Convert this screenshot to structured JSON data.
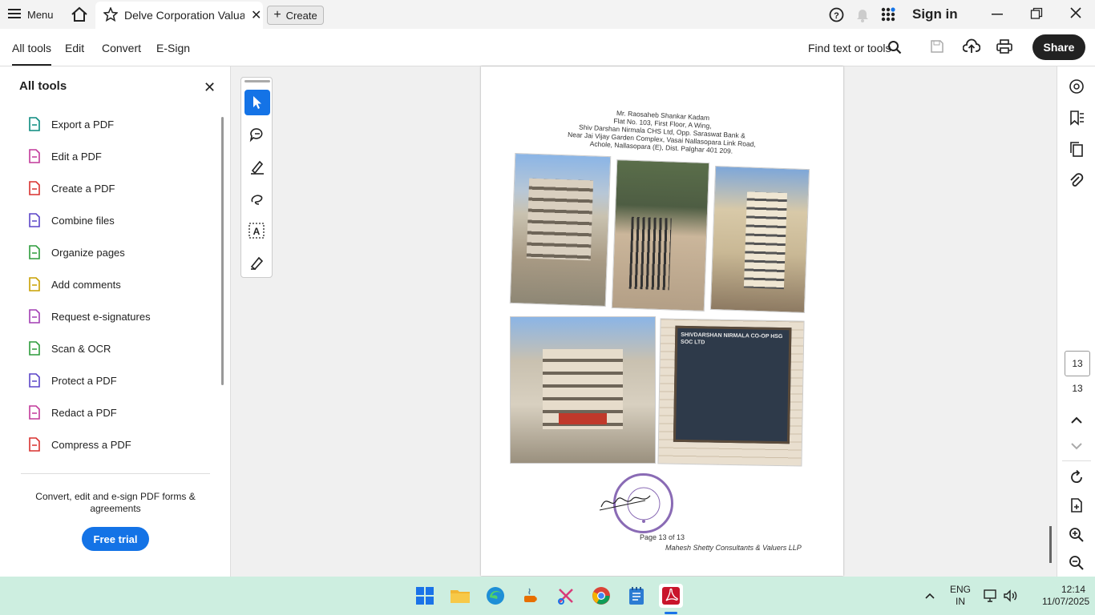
{
  "titlebar": {
    "menu_label": "Menu",
    "tab_title": "Delve Corporation Valua...",
    "create_label": "Create",
    "signin_label": "Sign in"
  },
  "toolbar": {
    "items": [
      "All tools",
      "Edit",
      "Convert",
      "E-Sign"
    ],
    "find_label": "Find text or tools",
    "share_label": "Share"
  },
  "panel": {
    "title": "All tools",
    "tools": [
      {
        "label": "Export a PDF",
        "icon": "export-pdf-icon",
        "color": "#0a8a7f"
      },
      {
        "label": "Edit a PDF",
        "icon": "edit-pdf-icon",
        "color": "#c2399a"
      },
      {
        "label": "Create a PDF",
        "icon": "create-pdf-icon",
        "color": "#d9312f"
      },
      {
        "label": "Combine files",
        "icon": "combine-files-icon",
        "color": "#5b45c8"
      },
      {
        "label": "Organize pages",
        "icon": "organize-pages-icon",
        "color": "#2d9c3c"
      },
      {
        "label": "Add comments",
        "icon": "add-comments-icon",
        "color": "#c9a000"
      },
      {
        "label": "Request e-signatures",
        "icon": "request-esign-icon",
        "color": "#a23db3"
      },
      {
        "label": "Scan & OCR",
        "icon": "scan-ocr-icon",
        "color": "#2d9c3c"
      },
      {
        "label": "Protect a PDF",
        "icon": "protect-pdf-icon",
        "color": "#5b45c8"
      },
      {
        "label": "Redact a PDF",
        "icon": "redact-pdf-icon",
        "color": "#c2399a"
      },
      {
        "label": "Compress a PDF",
        "icon": "compress-pdf-icon",
        "color": "#d9312f"
      }
    ],
    "promo_text": "Convert, edit and e-sign PDF forms & agreements",
    "trial_label": "Free trial"
  },
  "document": {
    "address_lines": [
      "Mr. Raosaheb Shankar Kadam",
      "Flat No. 103, First Floor, A Wing,",
      "Shiv Darshan Nirmala CHS Ltd, Opp. Saraswat Bank &",
      "Near Jai Vijay Garden Complex, Vasai Nallasopara Link Road,",
      "Achole, Nallasopara (E), Dist. Palghar 401 209."
    ],
    "board_text": "SHIVDARSHAN NIRMALA CO-OP HSG SOC LTD",
    "page_label": "Page 13 of 13",
    "firm_signature": "Mahesh Shetty Consultants & Valuers LLP"
  },
  "pager": {
    "current": "13",
    "total": "13"
  },
  "taskbar": {
    "lang_top": "ENG",
    "lang_bottom": "IN",
    "time": "12:14",
    "date": "11/07/2025"
  }
}
